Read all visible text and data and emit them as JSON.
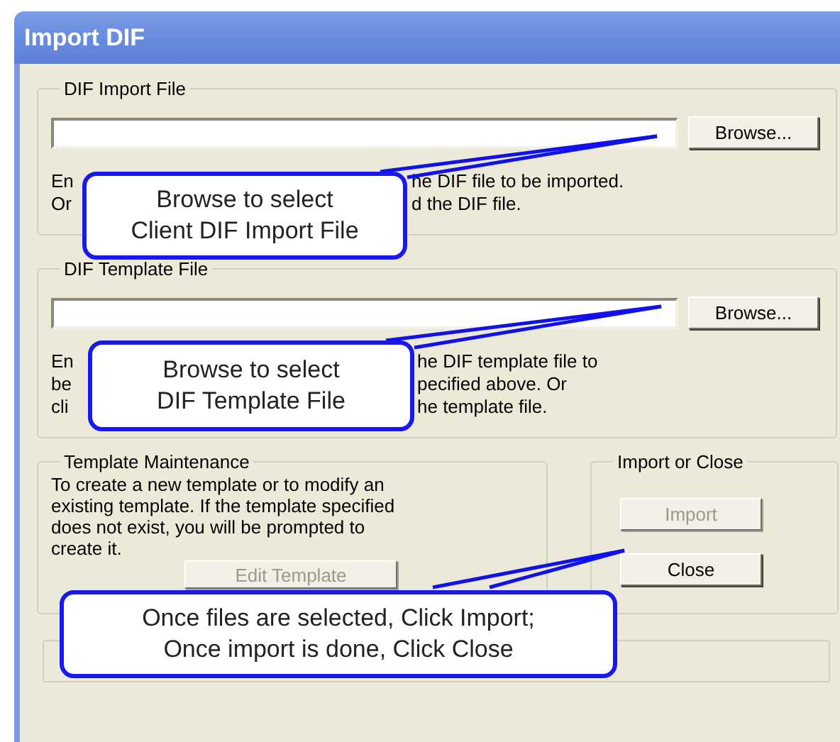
{
  "window": {
    "title": "Import DIF"
  },
  "file_groups": [
    {
      "title": "DIF Import File",
      "browse_button": {
        "label": "Browse...",
        "disabled": false
      },
      "description_visible": [
        {
          "start": "En",
          "end": "he DIF file to be imported."
        },
        {
          "start": "Or",
          "end": "d the DIF file."
        }
      ]
    },
    {
      "title": "DIF Template File",
      "browse_button": {
        "label": "Browse...",
        "disabled": false
      },
      "description_visible": [
        {
          "start": "En",
          "end": "he DIF template file to"
        },
        {
          "start": "be",
          "end": "pecified above. Or"
        },
        {
          "start": "cli",
          "end": "he template file."
        }
      ]
    }
  ],
  "template_maintenance": {
    "title": "Template Maintenance",
    "text": "To create a new template or to modify an\nexisting template. If the template specified\ndoes not exist, you will be prompted to\ncreate it.",
    "button": {
      "label": "Edit Template",
      "disabled": true
    }
  },
  "import_or_close": {
    "title": "Import or Close",
    "buttons": [
      {
        "label": "Import",
        "disabled": true
      },
      {
        "label": "Close",
        "disabled": false
      }
    ]
  },
  "callouts": [
    {
      "text": "Browse to select\nClient DIF Import File"
    },
    {
      "text": "Browse to select\nDIF Template File"
    },
    {
      "text": "Once files are selected, Click Import;\nOnce import is done, Click Close"
    }
  ]
}
